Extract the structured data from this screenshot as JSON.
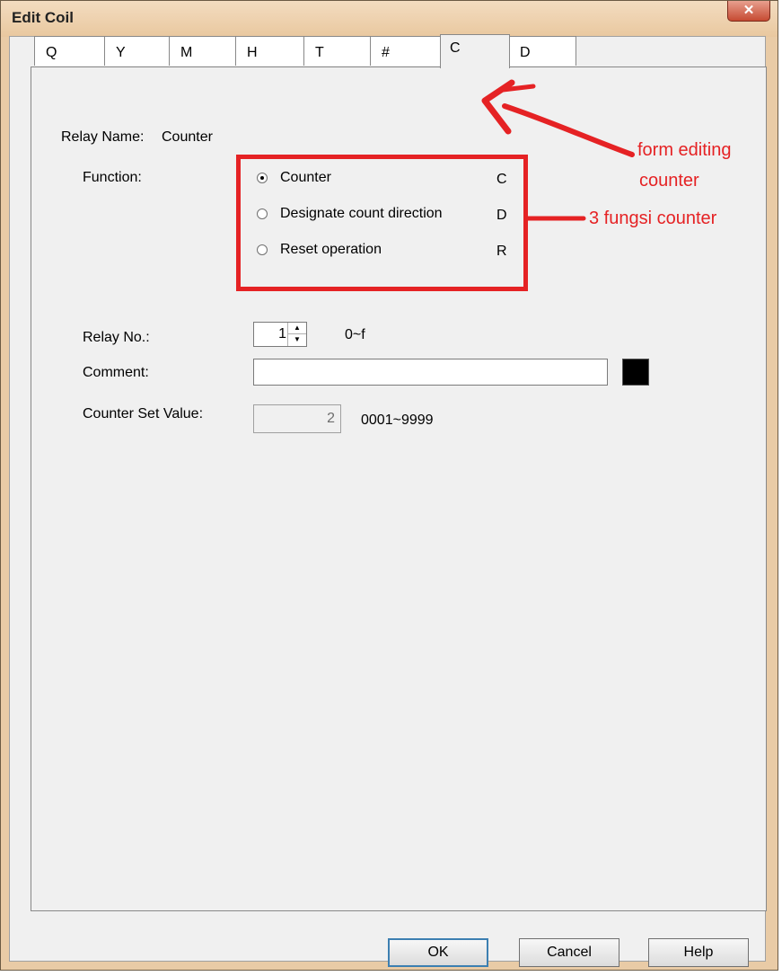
{
  "window": {
    "title": "Edit Coil",
    "close_symbol": "✕"
  },
  "tabs": [
    {
      "label": "Q"
    },
    {
      "label": "Y"
    },
    {
      "label": "M"
    },
    {
      "label": "H"
    },
    {
      "label": "T"
    },
    {
      "label": "#"
    },
    {
      "label": "C",
      "active": true
    },
    {
      "label": "D"
    }
  ],
  "form": {
    "relay_name_label": "Relay Name:",
    "relay_name_value": "Counter",
    "function_label": "Function:",
    "functions": [
      {
        "label": "Counter",
        "code": "C",
        "selected": true
      },
      {
        "label": "Designate count direction",
        "code": "D",
        "selected": false
      },
      {
        "label": "Reset operation",
        "code": "R",
        "selected": false
      }
    ],
    "relay_no_label": "Relay No.:",
    "relay_no_value": "1",
    "relay_no_range": "0~f",
    "comment_label": "Comment:",
    "comment_value": "",
    "counter_set_value_label": "Counter Set Value:",
    "counter_set_value": "2",
    "counter_set_range": "0001~9999"
  },
  "buttons": {
    "ok": "OK",
    "cancel": "Cancel",
    "help": "Help"
  },
  "annotations": {
    "arrow_note_line1": "form editing",
    "arrow_note_line2": "counter",
    "box_note": "3 fungsi counter",
    "color": "#e52224"
  }
}
